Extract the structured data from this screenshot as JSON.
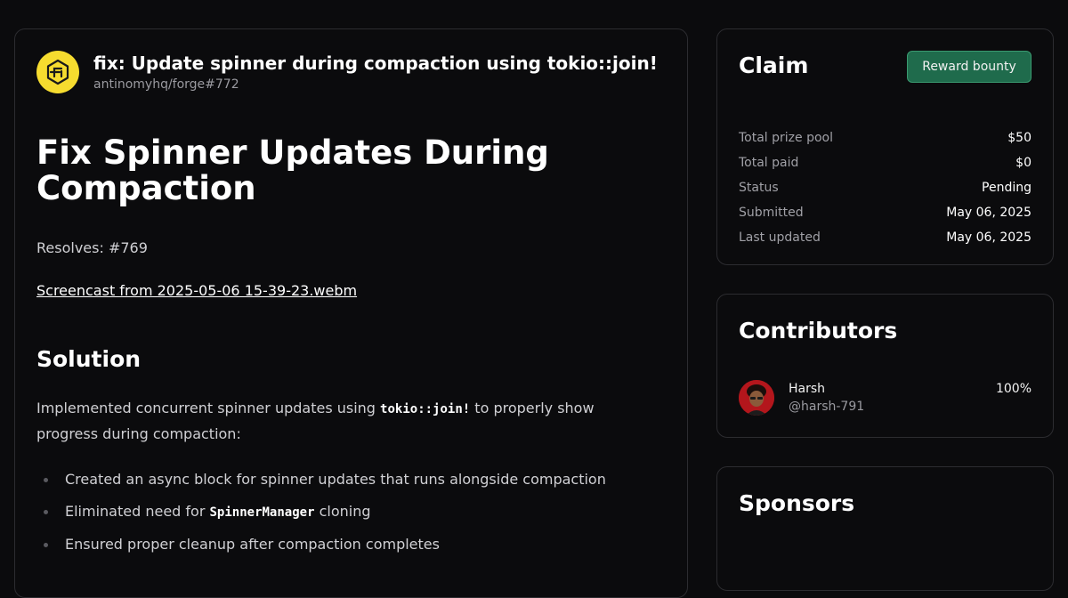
{
  "pr": {
    "title": "fix: Update spinner during compaction using tokio::join!",
    "ref": "antinomyhq/forge#772",
    "logo_icon": "forge-logo-icon"
  },
  "content": {
    "heading": "Fix Spinner Updates During Compaction",
    "resolves": "Resolves: #769",
    "link_text": "Screencast from 2025-05-06 15-39-23.webm",
    "solution_heading": "Solution",
    "para_before_code": "Implemented concurrent spinner updates using ",
    "para_code": "tokio::join!",
    "para_after_code": " to properly show progress during compaction:",
    "bullets": [
      {
        "text": "Created an async block for spinner updates that runs alongside compaction",
        "code": "",
        "after": ""
      },
      {
        "text": "Eliminated need for ",
        "code": "SpinnerManager",
        "after": " cloning"
      },
      {
        "text": "Ensured proper cleanup after compaction completes",
        "code": "",
        "after": ""
      }
    ]
  },
  "claim": {
    "title": "Claim",
    "button_label": "Reward bounty",
    "rows": [
      {
        "label": "Total prize pool",
        "value": "$50"
      },
      {
        "label": "Total paid",
        "value": "$0"
      },
      {
        "label": "Status",
        "value": "Pending"
      },
      {
        "label": "Submitted",
        "value": "May 06, 2025"
      },
      {
        "label": "Last updated",
        "value": "May 06, 2025"
      }
    ]
  },
  "contributors": {
    "title": "Contributors",
    "items": [
      {
        "name": "Harsh",
        "handle": "@harsh-791",
        "share": "100%"
      }
    ]
  },
  "sponsors": {
    "title": "Sponsors"
  },
  "colors": {
    "background": "#0b0b0d",
    "border": "#2c2c30",
    "accent_button": "#1f6b4c",
    "logo_yellow": "#f6dc2f",
    "avatar_red": "#b3161c"
  }
}
